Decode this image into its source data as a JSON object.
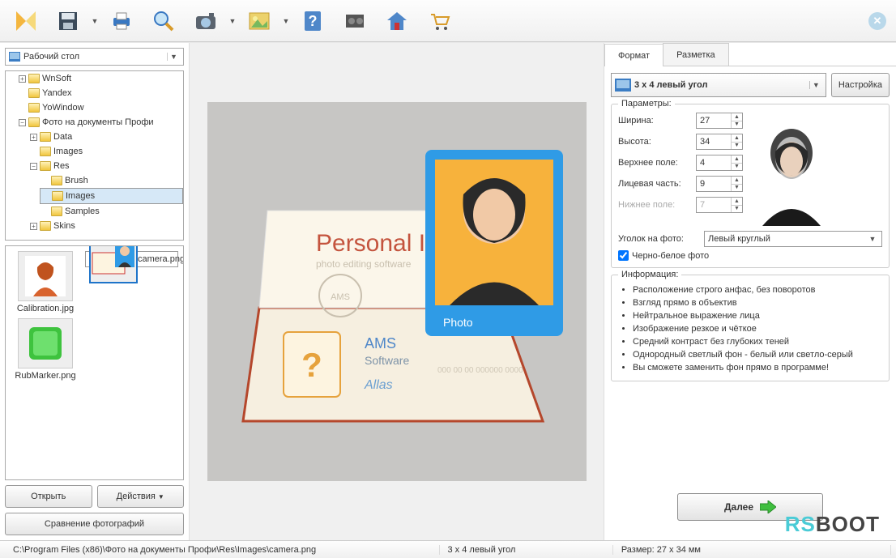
{
  "toolbar": {
    "icons": [
      "open",
      "save",
      "print",
      "search",
      "camera",
      "image",
      "help",
      "video",
      "home",
      "cart"
    ]
  },
  "sidebar": {
    "location": "Рабочий стол",
    "tree": [
      "WnSoft",
      "Yandex",
      "YoWindow",
      "Фото на документы Профи"
    ],
    "subfolders": [
      "Data",
      "Images",
      "Res"
    ],
    "resfolders": [
      "Brush",
      "Images",
      "Samples"
    ],
    "skins": "Skins",
    "thumbs": [
      "Calibration.jpg",
      "camera.png",
      "RubMarker.png"
    ],
    "open_btn": "Открыть",
    "actions_btn": "Действия",
    "compare_btn": "Сравнение фотографий"
  },
  "tabs": {
    "format": "Формат",
    "layout": "Разметка"
  },
  "format": {
    "selected": "3 x 4 левый угол",
    "settings_btn": "Настройка",
    "group_params": "Параметры:",
    "width_l": "Ширина:",
    "width_v": "27",
    "height_l": "Высота:",
    "height_v": "34",
    "top_l": "Верхнее поле:",
    "top_v": "4",
    "face_l": "Лицевая часть:",
    "face_v": "9",
    "bottom_l": "Нижнее поле:",
    "bottom_v": "7",
    "corner_l": "Уголок на фото:",
    "corner_v": "Левый круглый",
    "bw_l": "Черно-белое фото",
    "group_info": "Информация:",
    "info": [
      "Расположение строго анфас, без поворотов",
      "Взгляд прямо в объектив",
      "Нейтральное выражение лица",
      "Изображение резкое и чёткое",
      "Средний контраст без глубоких теней",
      "Однородный светлый фон - белый или светло-серый",
      "Вы сможете заменить фон прямо в программе!"
    ],
    "next_btn": "Далее"
  },
  "preview": {
    "title": "Personal ID",
    "sub": "photo editing software",
    "stamp": "AMS",
    "brand1": "AMS",
    "brand2": "Software",
    "photo_label": "Photo"
  },
  "status": {
    "path": "C:\\Program Files (x86)\\Фото на документы Профи\\Res\\Images\\camera.png",
    "fmt": "3 x 4 левый угол",
    "size": "Размер: 27 x 34 мм"
  },
  "logo": {
    "a": "RS",
    "b": "BOOT"
  }
}
